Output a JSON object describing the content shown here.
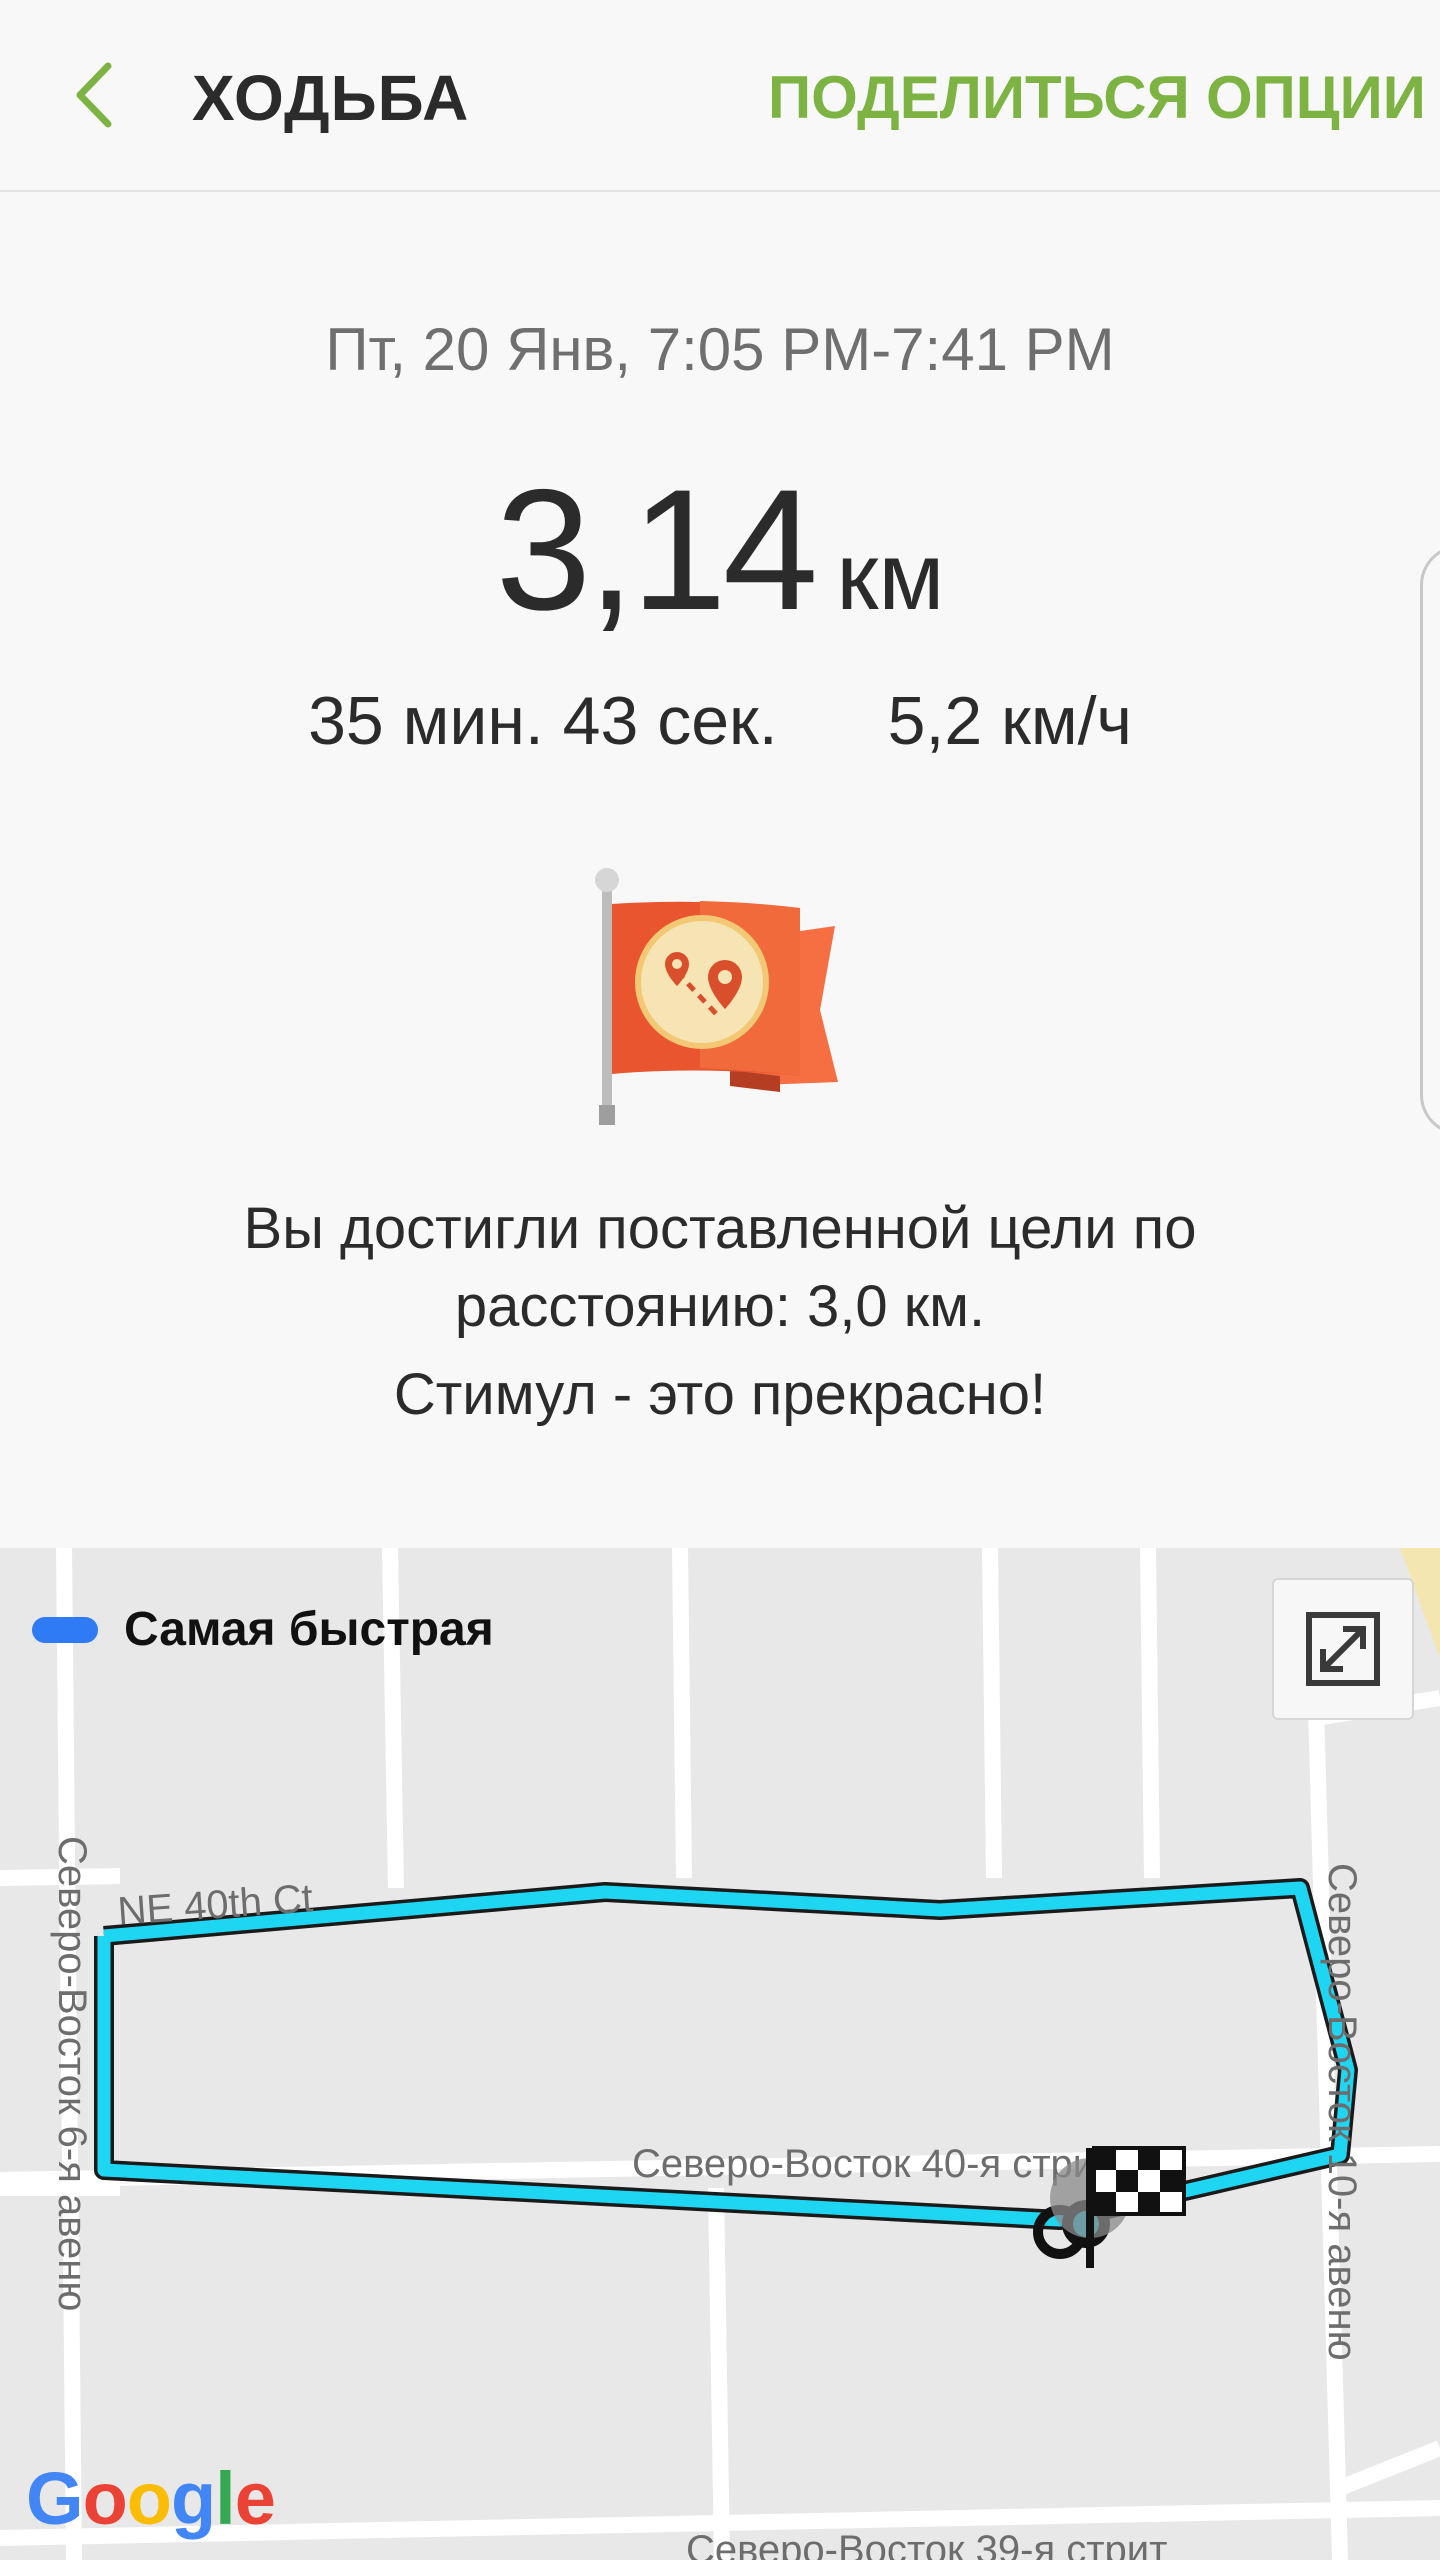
{
  "header": {
    "back_icon": "chevron-left-icon",
    "title": "ХОДЬБА",
    "share_label": "ПОДЕЛИТЬСЯ",
    "options_label": "ОПЦИИ",
    "accent_color": "#7cb342"
  },
  "summary": {
    "date_range": "Пт, 20 Янв, 7:05 PM-7:41 PM",
    "distance_value": "3,14",
    "distance_unit": "км",
    "duration": "35 мин. 43 сек.",
    "speed": "5,2 км/ч",
    "badge_icon": "goal-flag-map-icon",
    "goal_text": "Вы достигли поставленной цели по расстоянию: 3,0 км.",
    "goal_sub": "Стимул - это прекрасно!"
  },
  "map": {
    "legend_label": "Самая быстрая",
    "legend_color": "#2f7bf6",
    "route_color": "#1fd6f2",
    "expand_icon": "expand-icon",
    "finish_icon": "checkered-flag-icon",
    "streets": {
      "ne40": "NE 40th Ct",
      "ne40_avenue_street": "Северо-Восток 40-я стрит",
      "ne39": "Северо-Восток 39-я стрит",
      "ave6": "Северо-Восток 6-я авеню",
      "ave10": "Северо-Восток 10-я авеню"
    },
    "attribution": "Google"
  }
}
